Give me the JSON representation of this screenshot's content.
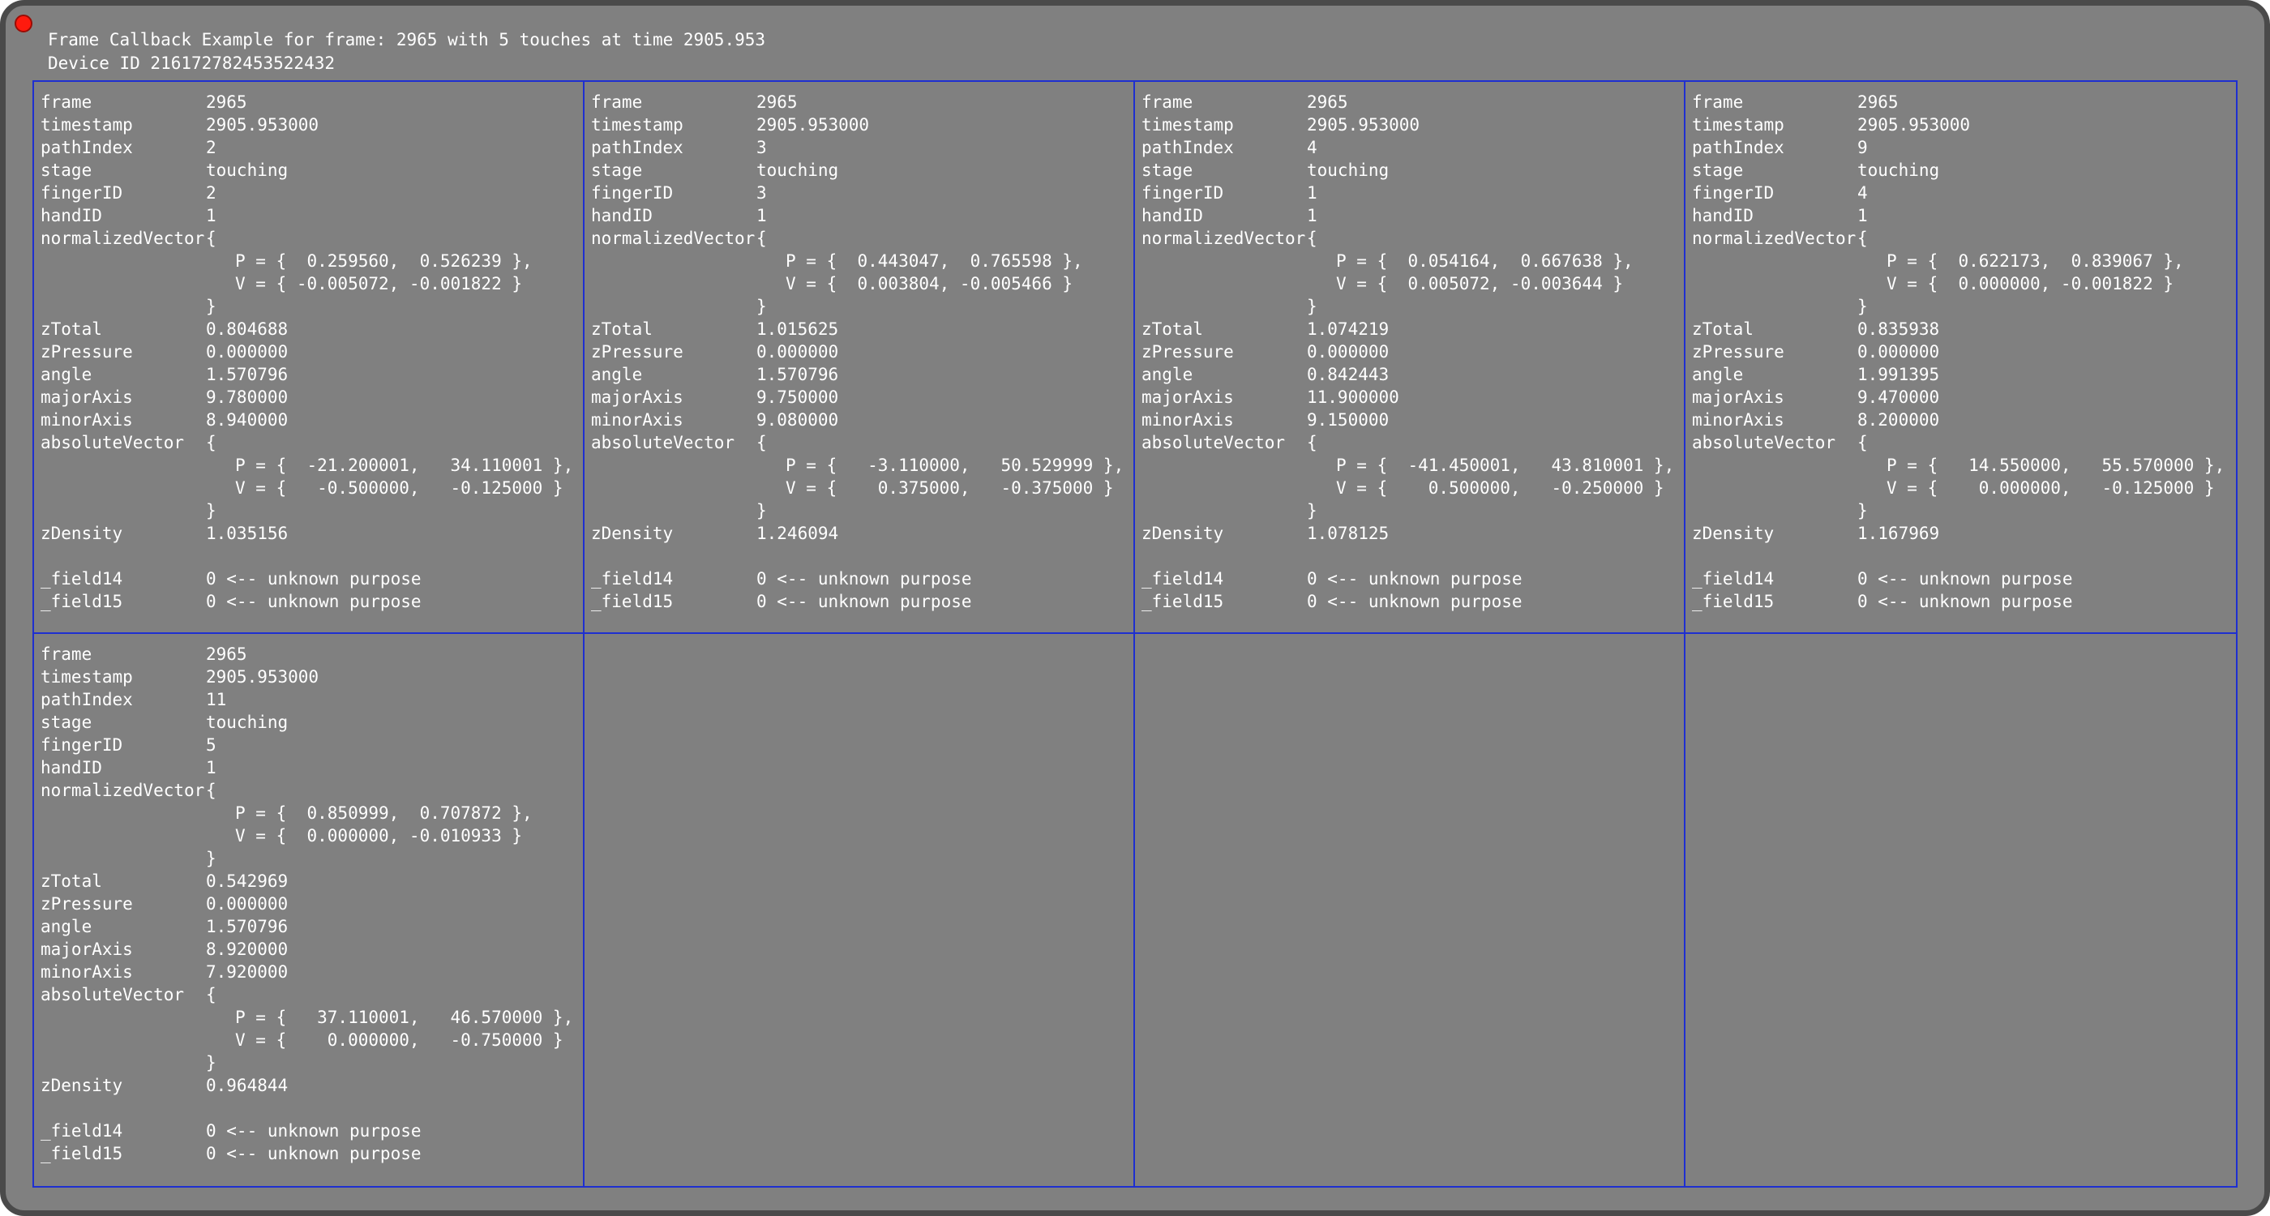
{
  "window": {
    "title_line": "Frame Callback Example for frame: 2965 with 5 touches at time 2905.953",
    "device_line": "Device ID 216172782453522432",
    "colors": {
      "background": "#808080",
      "grid_border": "#1e2fd0",
      "text": "#ffffff",
      "close_button": "#ff1a0e"
    },
    "close_icon": "red-circle-close-icon"
  },
  "touches": [
    {
      "frame": "2965",
      "timestamp": "2905.953000",
      "pathIndex": "2",
      "stage": "touching",
      "fingerID": "2",
      "handID": "1",
      "normalizedVector": {
        "open": "{",
        "P": "P = {  0.259560,  0.526239 },",
        "V": "V = { -0.005072, -0.001822 }",
        "close": "}"
      },
      "zTotal": "0.804688",
      "zPressure": "0.000000",
      "angle": "1.570796",
      "majorAxis": "9.780000",
      "minorAxis": "8.940000",
      "absoluteVector": {
        "open": "{",
        "P": "P = {  -21.200001,   34.110001 },",
        "V": "V = {   -0.500000,   -0.125000 }",
        "close": "}"
      },
      "zDensity": "1.035156",
      "_field14": "0 <-- unknown purpose",
      "_field15": "0 <-- unknown purpose"
    },
    {
      "frame": "2965",
      "timestamp": "2905.953000",
      "pathIndex": "3",
      "stage": "touching",
      "fingerID": "3",
      "handID": "1",
      "normalizedVector": {
        "open": "{",
        "P": "P = {  0.443047,  0.765598 },",
        "V": "V = {  0.003804, -0.005466 }",
        "close": "}"
      },
      "zTotal": "1.015625",
      "zPressure": "0.000000",
      "angle": "1.570796",
      "majorAxis": "9.750000",
      "minorAxis": "9.080000",
      "absoluteVector": {
        "open": "{",
        "P": "P = {   -3.110000,   50.529999 },",
        "V": "V = {    0.375000,   -0.375000 }",
        "close": "}"
      },
      "zDensity": "1.246094",
      "_field14": "0 <-- unknown purpose",
      "_field15": "0 <-- unknown purpose"
    },
    {
      "frame": "2965",
      "timestamp": "2905.953000",
      "pathIndex": "4",
      "stage": "touching",
      "fingerID": "1",
      "handID": "1",
      "normalizedVector": {
        "open": "{",
        "P": "P = {  0.054164,  0.667638 },",
        "V": "V = {  0.005072, -0.003644 }",
        "close": "}"
      },
      "zTotal": "1.074219",
      "zPressure": "0.000000",
      "angle": "0.842443",
      "majorAxis": "11.900000",
      "minorAxis": "9.150000",
      "absoluteVector": {
        "open": "{",
        "P": "P = {  -41.450001,   43.810001 },",
        "V": "V = {    0.500000,   -0.250000 }",
        "close": "}"
      },
      "zDensity": "1.078125",
      "_field14": "0 <-- unknown purpose",
      "_field15": "0 <-- unknown purpose"
    },
    {
      "frame": "2965",
      "timestamp": "2905.953000",
      "pathIndex": "9",
      "stage": "touching",
      "fingerID": "4",
      "handID": "1",
      "normalizedVector": {
        "open": "{",
        "P": "P = {  0.622173,  0.839067 },",
        "V": "V = {  0.000000, -0.001822 }",
        "close": "}"
      },
      "zTotal": "0.835938",
      "zPressure": "0.000000",
      "angle": "1.991395",
      "majorAxis": "9.470000",
      "minorAxis": "8.200000",
      "absoluteVector": {
        "open": "{",
        "P": "P = {   14.550000,   55.570000 },",
        "V": "V = {    0.000000,   -0.125000 }",
        "close": "}"
      },
      "zDensity": "1.167969",
      "_field14": "0 <-- unknown purpose",
      "_field15": "0 <-- unknown purpose"
    },
    {
      "frame": "2965",
      "timestamp": "2905.953000",
      "pathIndex": "11",
      "stage": "touching",
      "fingerID": "5",
      "handID": "1",
      "normalizedVector": {
        "open": "{",
        "P": "P = {  0.850999,  0.707872 },",
        "V": "V = {  0.000000, -0.010933 }",
        "close": "}"
      },
      "zTotal": "0.542969",
      "zPressure": "0.000000",
      "angle": "1.570796",
      "majorAxis": "8.920000",
      "minorAxis": "7.920000",
      "absoluteVector": {
        "open": "{",
        "P": "P = {   37.110001,   46.570000 },",
        "V": "V = {    0.000000,   -0.750000 }",
        "close": "}"
      },
      "zDensity": "0.964844",
      "_field14": "0 <-- unknown purpose",
      "_field15": "0 <-- unknown purpose"
    }
  ]
}
